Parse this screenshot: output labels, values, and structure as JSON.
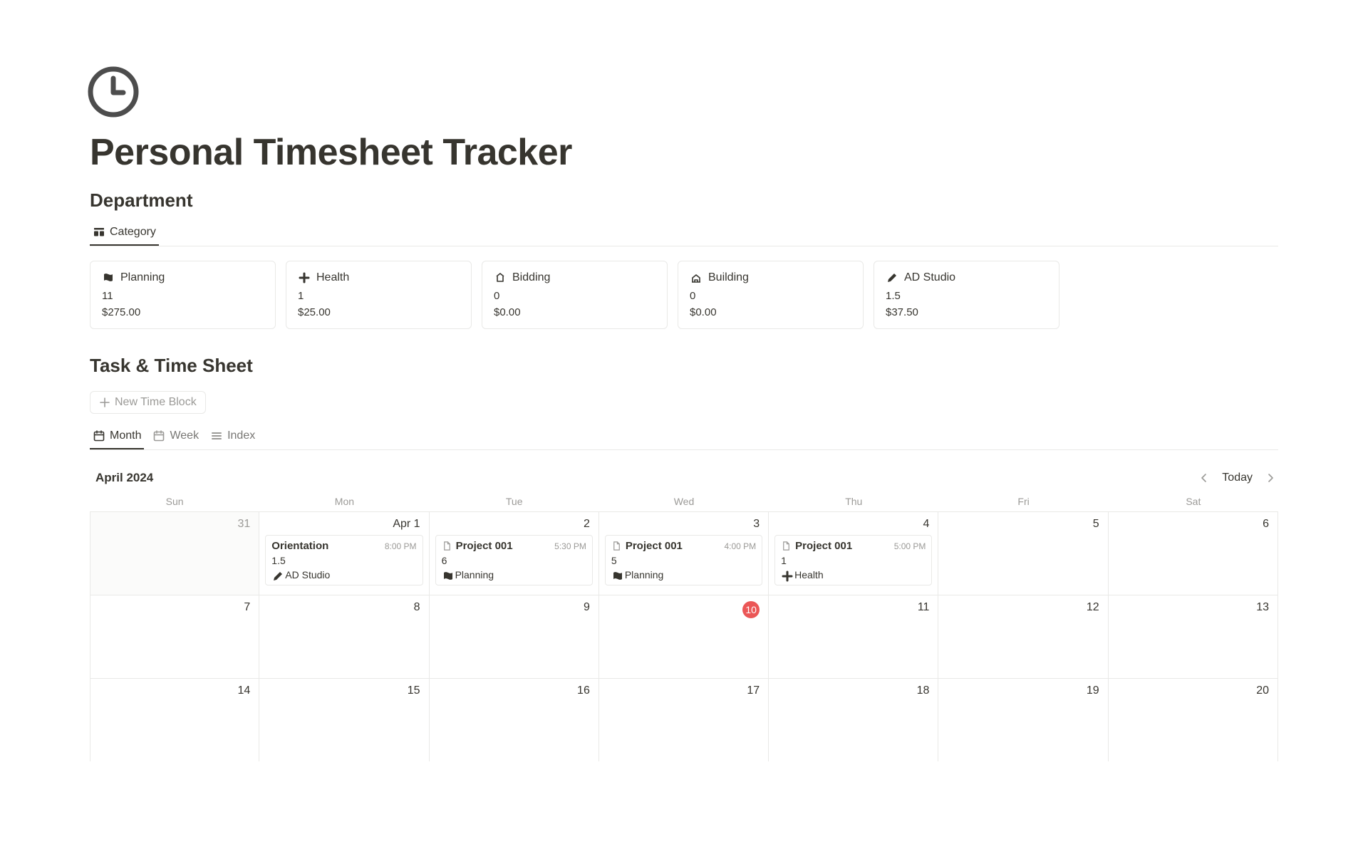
{
  "page_title": "Personal Timesheet Tracker",
  "sections": {
    "department": "Department",
    "tasksheet": "Task & Time Sheet"
  },
  "dept_tabs": [
    {
      "label": "Category",
      "icon": "gallery"
    }
  ],
  "categories": [
    {
      "icon": "planning",
      "name": "Planning",
      "hours": "11",
      "amount": "$275.00"
    },
    {
      "icon": "health",
      "name": "Health",
      "hours": "1",
      "amount": "$25.00"
    },
    {
      "icon": "bidding",
      "name": "Bidding",
      "hours": "0",
      "amount": "$0.00"
    },
    {
      "icon": "building",
      "name": "Building",
      "hours": "0",
      "amount": "$0.00"
    },
    {
      "icon": "pencil",
      "name": "AD Studio",
      "hours": "1.5",
      "amount": "$37.50"
    }
  ],
  "new_block_label": "New Time Block",
  "view_tabs": [
    {
      "label": "Month",
      "icon": "calendar",
      "active": true
    },
    {
      "label": "Week",
      "icon": "calendar",
      "active": false
    },
    {
      "label": "Index",
      "icon": "list",
      "active": false
    }
  ],
  "calendar": {
    "month_label": "April 2024",
    "today_label": "Today",
    "dow": [
      "Sun",
      "Mon",
      "Tue",
      "Wed",
      "Thu",
      "Fri",
      "Sat"
    ],
    "weeks": [
      [
        {
          "num": "31",
          "outside": true
        },
        {
          "num": "Apr 1",
          "events": [
            {
              "title": "Orientation",
              "time": "8:00 PM",
              "hours": "1.5",
              "tag_icon": "pencil",
              "tag": "AD Studio",
              "doc_icon": false
            }
          ]
        },
        {
          "num": "2",
          "events": [
            {
              "title": "Project 001",
              "time": "5:30 PM",
              "hours": "6",
              "tag_icon": "planning",
              "tag": "Planning",
              "doc_icon": true
            }
          ]
        },
        {
          "num": "3",
          "events": [
            {
              "title": "Project 001",
              "time": "4:00 PM",
              "hours": "5",
              "tag_icon": "planning",
              "tag": "Planning",
              "doc_icon": true
            }
          ]
        },
        {
          "num": "4",
          "events": [
            {
              "title": "Project 001",
              "time": "5:00 PM",
              "hours": "1",
              "tag_icon": "health",
              "tag": "Health",
              "doc_icon": true
            }
          ]
        },
        {
          "num": "5"
        },
        {
          "num": "6"
        }
      ],
      [
        {
          "num": "7"
        },
        {
          "num": "8"
        },
        {
          "num": "9"
        },
        {
          "num": "10",
          "today": true
        },
        {
          "num": "11"
        },
        {
          "num": "12"
        },
        {
          "num": "13"
        }
      ],
      [
        {
          "num": "14"
        },
        {
          "num": "15"
        },
        {
          "num": "16"
        },
        {
          "num": "17"
        },
        {
          "num": "18"
        },
        {
          "num": "19"
        },
        {
          "num": "20"
        }
      ]
    ]
  }
}
